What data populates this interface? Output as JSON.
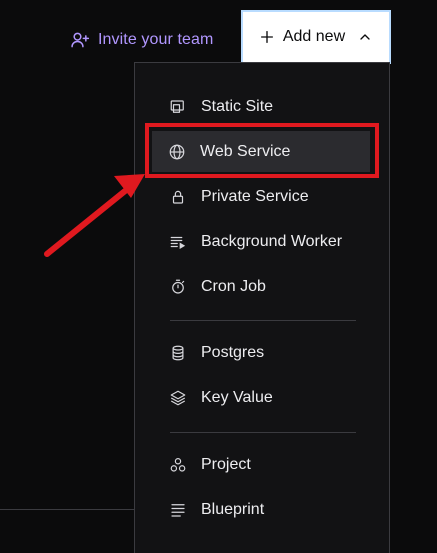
{
  "topbar": {
    "invite_label": "Invite your team",
    "add_new_label": "Add new"
  },
  "menu": {
    "items": [
      {
        "label": "Static Site",
        "icon": "static-site-icon"
      },
      {
        "label": "Web Service",
        "icon": "globe-icon",
        "highlighted": true
      },
      {
        "label": "Private Service",
        "icon": "lock-icon"
      },
      {
        "label": "Background Worker",
        "icon": "background-worker-icon"
      },
      {
        "label": "Cron Job",
        "icon": "timer-icon"
      },
      {
        "label": "Postgres",
        "icon": "database-icon"
      },
      {
        "label": "Key Value",
        "icon": "layers-icon"
      },
      {
        "label": "Project",
        "icon": "project-icon"
      },
      {
        "label": "Blueprint",
        "icon": "blueprint-icon"
      }
    ]
  },
  "colors": {
    "accent_purple": "#b197ff",
    "annotation_red": "#e0191f",
    "panel_bg": "#121214",
    "page_bg": "#0b0b0c"
  }
}
